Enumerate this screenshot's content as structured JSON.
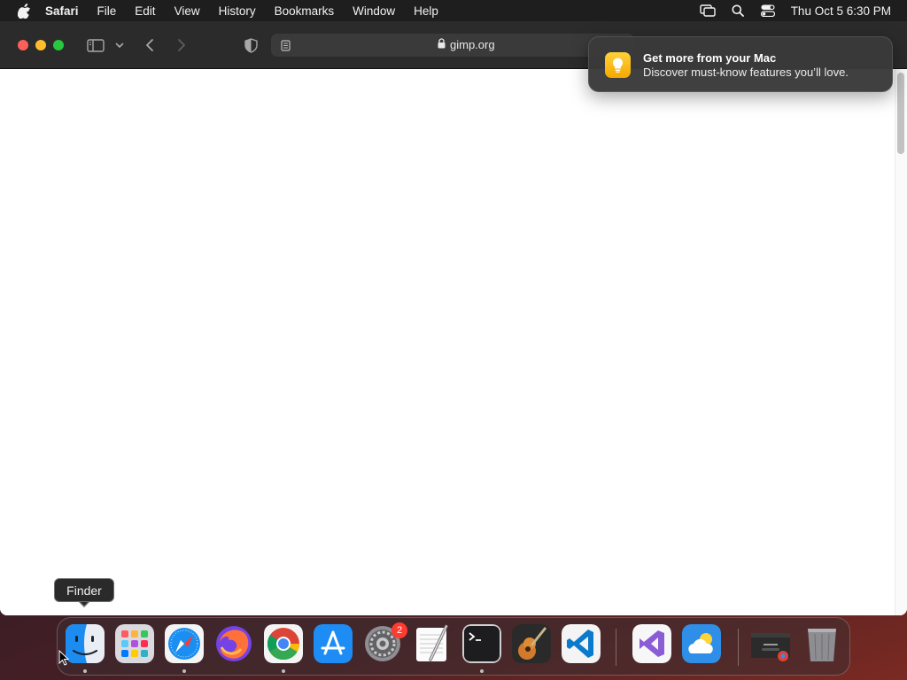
{
  "menubar": {
    "app_name": "Safari",
    "items": [
      "File",
      "Edit",
      "View",
      "History",
      "Bookmarks",
      "Window",
      "Help"
    ],
    "clock": "Thu Oct 5  6:30 PM"
  },
  "browser": {
    "url": "gimp.org"
  },
  "notification": {
    "title": "Get more from your Mac",
    "body": "Discover must-know features you’ll love."
  },
  "tooltip": {
    "label": "Finder"
  },
  "dock": {
    "apps": [
      "Finder",
      "Launchpad",
      "Safari",
      "Firefox",
      "Google Chrome",
      "App Store",
      "System Settings",
      "TextEdit",
      "Terminal",
      "GarageBand",
      "Visual Studio Code",
      "Visual Studio",
      "Weather",
      "Chrome window",
      "Trash"
    ],
    "settings_badge": "2"
  },
  "colors": {
    "close": "#fe5f57",
    "minimize": "#febc2e",
    "maximize": "#28c840",
    "badge": "#ff3b30"
  }
}
